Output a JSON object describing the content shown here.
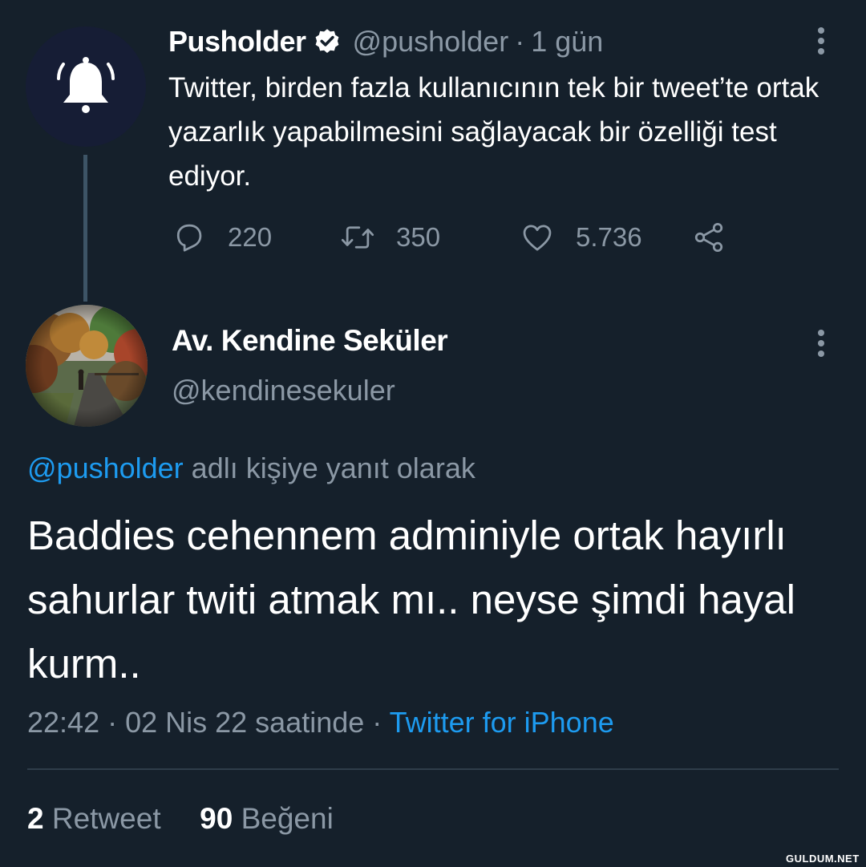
{
  "parent_tweet": {
    "display_name": "Pusholder",
    "handle": "@pusholder",
    "separator": "·",
    "time": "1 gün",
    "text": "Twitter, birden fazla kullanıcının tek bir tweet’te ortak yazarlık yapabilmesini sağlayacak bir özelliği test ediyor.",
    "replies": "220",
    "retweets": "350",
    "likes": "5.736"
  },
  "reply_tweet": {
    "display_name": "Av. Kendine Seküler",
    "handle": "@kendinesekuler",
    "reply_to_mention": "@pusholder",
    "reply_to_suffix": " adlı kişiye yanıt olarak",
    "text": "Baddies cehennem adminiyle ortak hayırlı sahurlar twiti atmak mı.. neyse şimdi hayal kurm..",
    "timestamp": "22:42 · 02 Nis 22 saatinde",
    "meta_separator": " · ",
    "source": "Twitter for iPhone",
    "retweet_count": "2",
    "retweet_label": "Retweet",
    "like_count": "90",
    "like_label": "Beğeni"
  },
  "watermark": "GULDUM.NET",
  "colors": {
    "background": "#15202b",
    "text_primary": "#ffffff",
    "text_secondary": "#8b98a5",
    "accent": "#1d9bf0",
    "divider": "#2f3d4a"
  },
  "icons": {
    "parent_avatar": "bell-icon",
    "verified": "verified-badge-icon",
    "reply": "reply-icon",
    "retweet": "retweet-icon",
    "like": "heart-icon",
    "share": "share-icon",
    "more": "more-vertical-icon"
  }
}
